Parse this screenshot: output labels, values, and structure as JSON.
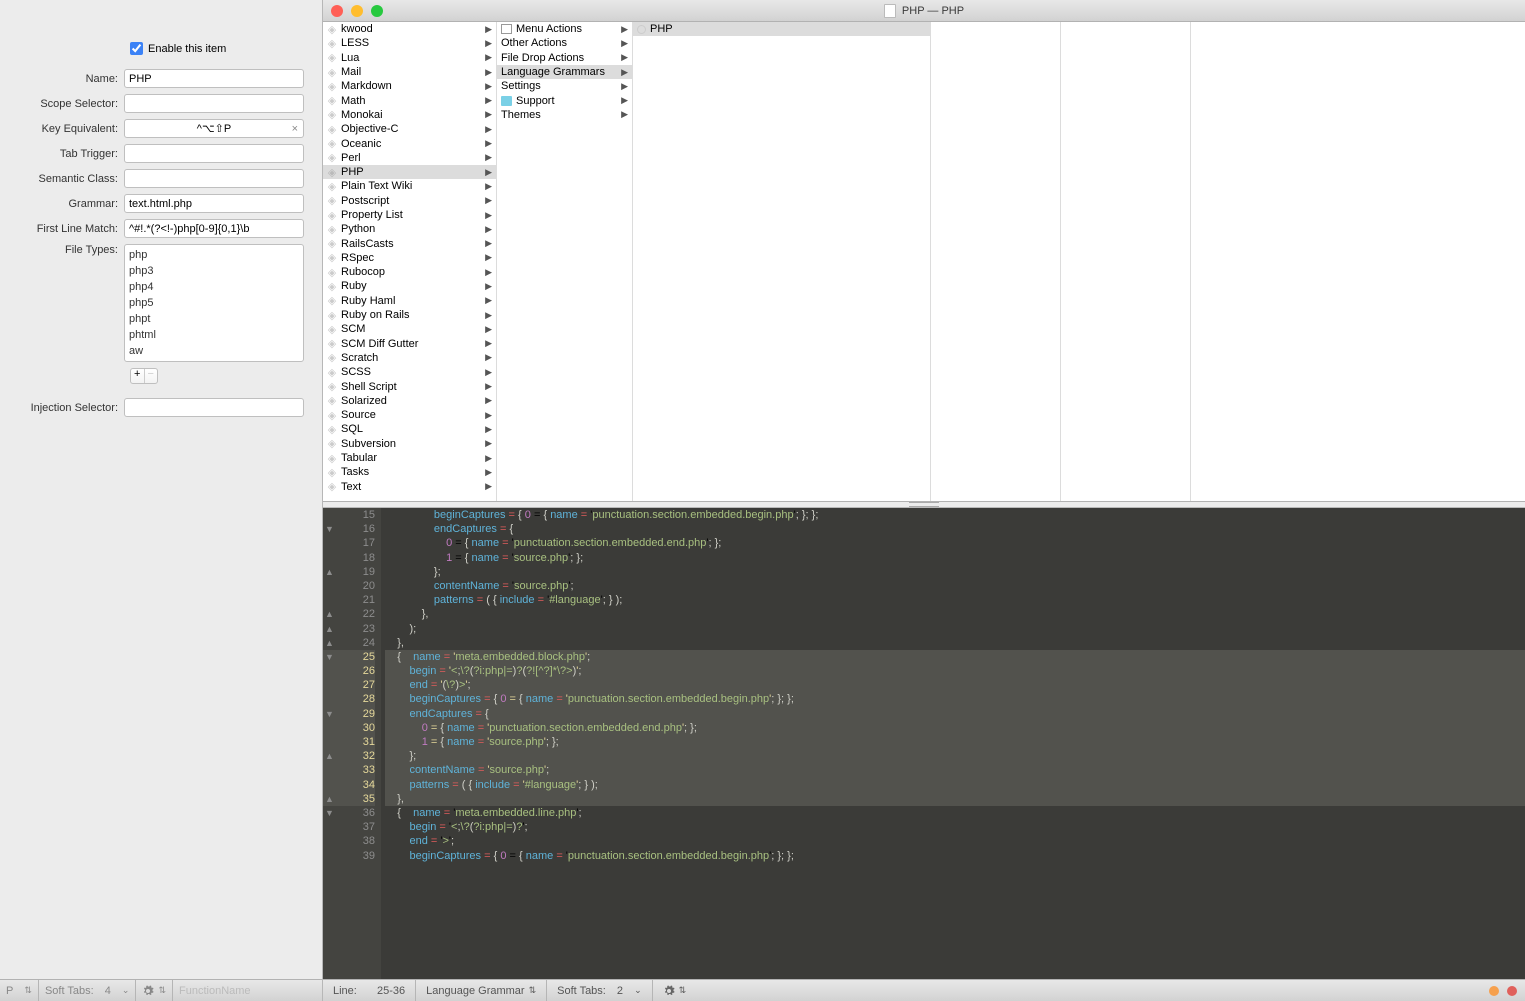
{
  "window_title": "PHP — PHP",
  "enable_label": "Enable this item",
  "form": {
    "name_label": "Name:",
    "name_value": "PHP",
    "scope_label": "Scope Selector:",
    "scope_value": "",
    "key_label": "Key Equivalent:",
    "key_value": "^⌥⇧P",
    "tab_label": "Tab Trigger:",
    "tab_value": "",
    "sem_label": "Semantic Class:",
    "sem_value": "",
    "gram_label": "Grammar:",
    "gram_value": "text.html.php",
    "flm_label": "First Line Match:",
    "flm_value": "^#!.*(?<!-)php[0-9]{0,1}\\b",
    "ft_label": "File Types:",
    "ft_list": [
      "php",
      "php3",
      "php4",
      "php5",
      "phpt",
      "phtml",
      "aw"
    ],
    "inj_label": "Injection Selector:",
    "inj_value": ""
  },
  "col1": [
    "kwood",
    "LESS",
    "Lua",
    "Mail",
    "Markdown",
    "Math",
    "Monokai",
    "Objective-C",
    "Oceanic",
    "Perl",
    "PHP",
    "Plain Text Wiki",
    "Postscript",
    "Property List",
    "Python",
    "RailsCasts",
    "RSpec",
    "Rubocop",
    "Ruby",
    "Ruby Haml",
    "Ruby on Rails",
    "SCM",
    "SCM Diff Gutter",
    "Scratch",
    "SCSS",
    "Shell Script",
    "Solarized",
    "Source",
    "SQL",
    "Subversion",
    "Tabular",
    "Tasks",
    "Text"
  ],
  "col1_sel": "PHP",
  "col2": [
    {
      "label": "Menu Actions",
      "icon": "menu"
    },
    {
      "label": "Other Actions"
    },
    {
      "label": "File Drop Actions"
    },
    {
      "label": "Language Grammars",
      "sel": true
    },
    {
      "label": "Settings"
    },
    {
      "label": "Support",
      "icon": "folder"
    },
    {
      "label": "Themes"
    }
  ],
  "col3": [
    {
      "label": "PHP",
      "sel": true
    }
  ],
  "code_lines": [
    {
      "n": 15,
      "t": "                beginCaptures = { 0 = { name = 'punctuation.section.embedded.begin.php'; }; };"
    },
    {
      "n": 16,
      "fold": "▼",
      "t": "                endCaptures = {"
    },
    {
      "n": 17,
      "t": "                    0 = { name = 'punctuation.section.embedded.end.php'; };"
    },
    {
      "n": 18,
      "t": "                    1 = { name = 'source.php'; };"
    },
    {
      "n": 19,
      "fold": "▲",
      "t": "                };"
    },
    {
      "n": 20,
      "t": "                contentName = 'source.php';"
    },
    {
      "n": 21,
      "t": "                patterns = ( { include = '#language'; } );"
    },
    {
      "n": 22,
      "fold": "▲",
      "t": "            },"
    },
    {
      "n": 23,
      "fold": "▲",
      "t": "        );"
    },
    {
      "n": 24,
      "fold": "▲",
      "t": "    },"
    },
    {
      "n": 25,
      "fold": "▼",
      "sel": true,
      "t": "    {    name = 'meta.embedded.block.php';"
    },
    {
      "n": 26,
      "sel": true,
      "t": "        begin = '<\\?(?i:php|=)?(?![^?]*\\?>)';"
    },
    {
      "n": 27,
      "sel": true,
      "t": "        end = '(\\?)>';"
    },
    {
      "n": 28,
      "sel": true,
      "t": "        beginCaptures = { 0 = { name = 'punctuation.section.embedded.begin.php'; }; };"
    },
    {
      "n": 29,
      "fold": "▼",
      "sel": true,
      "t": "        endCaptures = {"
    },
    {
      "n": 30,
      "sel": true,
      "t": "            0 = { name = 'punctuation.section.embedded.end.php'; };"
    },
    {
      "n": 31,
      "sel": true,
      "t": "            1 = { name = 'source.php'; };"
    },
    {
      "n": 32,
      "fold": "▲",
      "sel": true,
      "t": "        };"
    },
    {
      "n": 33,
      "sel": true,
      "t": "        contentName = 'source.php';"
    },
    {
      "n": 34,
      "sel": true,
      "t": "        patterns = ( { include = '#language'; } );"
    },
    {
      "n": 35,
      "fold": "▲",
      "sel": true,
      "t": "    },"
    },
    {
      "n": 36,
      "fold": "▼",
      "t": "    {    name = 'meta.embedded.line.php';"
    },
    {
      "n": 37,
      "t": "        begin = '<\\?(?i:php|=)?';"
    },
    {
      "n": 38,
      "t": "        end = '>';"
    },
    {
      "n": 39,
      "t": "        beginCaptures = { 0 = { name = 'punctuation.section.embedded.begin.php'; }; };"
    }
  ],
  "status": {
    "line_label": "Line:",
    "line_val": "25-36",
    "lang": "Language Grammar",
    "softtabs": "Soft Tabs:",
    "tabnum": "2",
    "left_cur": "P",
    "left_soft": "Soft Tabs:",
    "left_num": "4",
    "func": "FunctionName"
  }
}
